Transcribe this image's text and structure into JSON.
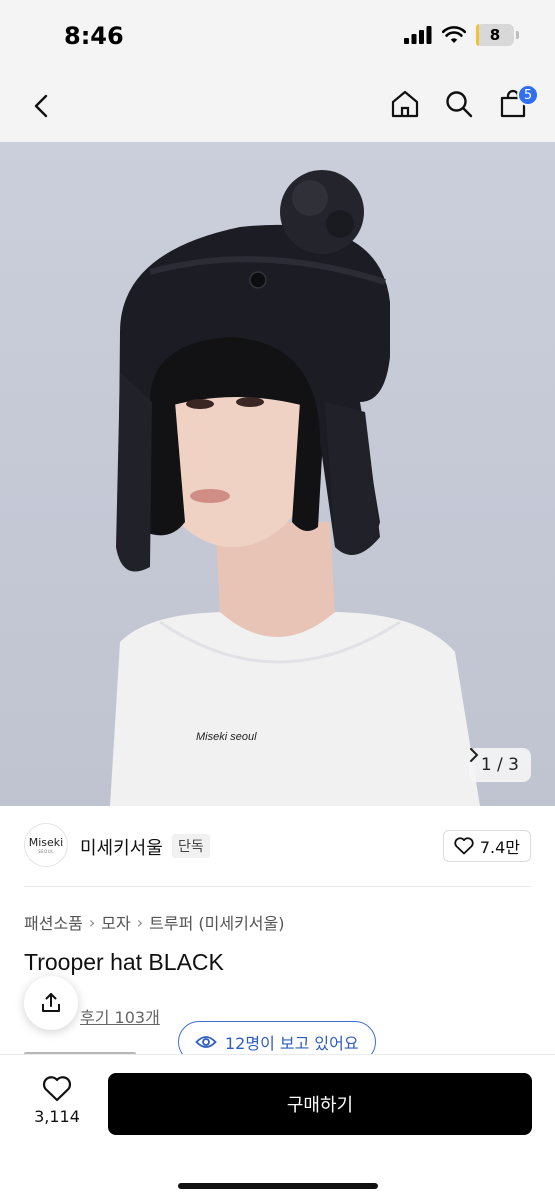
{
  "status_bar": {
    "time": "8:46",
    "battery": "8",
    "battery_level": 0.08
  },
  "nav": {
    "cart_count": "5",
    "icons": [
      "back-icon",
      "home-icon",
      "search-icon",
      "cart-icon"
    ]
  },
  "hero": {
    "pager_text": "1 / 3",
    "shirt_text": "Miseki seoul"
  },
  "brand": {
    "logo_text": "Miseki",
    "logo_sub": "SEOUL",
    "name": "미세키서울",
    "tag": "단독",
    "likes": "7.4만"
  },
  "breadcrumb": [
    "패션소품",
    "모자",
    "트루퍼 (미세키서울)"
  ],
  "product": {
    "title": "Trooper hat BLACK",
    "review_link": "후기 103개",
    "viewing": "12명이 보고 있어요"
  },
  "bottom": {
    "wish_count": "3,114",
    "buy_label": "구매하기"
  },
  "colors": {
    "accent_blue": "#2f6ff0",
    "pill_blue": "#2e5cc0",
    "buy_bg": "#000000"
  }
}
